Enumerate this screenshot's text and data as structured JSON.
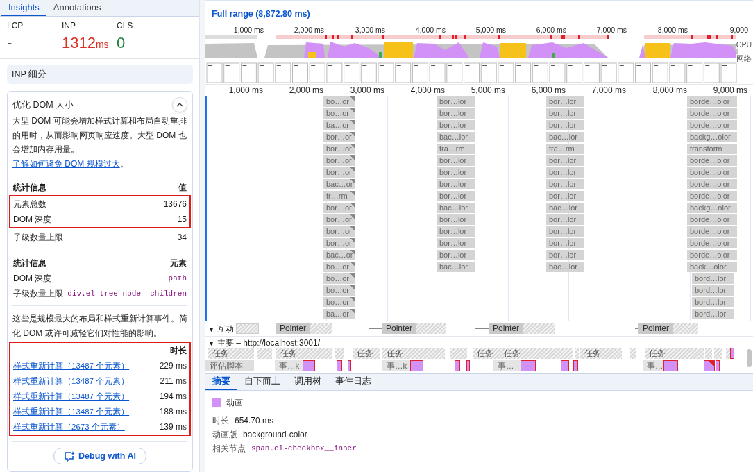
{
  "sidebar": {
    "tabs": [
      {
        "label": "Insights",
        "selected": true
      },
      {
        "label": "Annotations",
        "selected": false
      }
    ],
    "metrics": [
      {
        "name": "LCP",
        "value": "-",
        "color": "#202124"
      },
      {
        "name": "INP",
        "value": "1312",
        "unit": "ms",
        "color": "#d93025"
      },
      {
        "name": "CLS",
        "value": "0",
        "color": "#188038"
      }
    ],
    "breakdown_card": {
      "title": "INP 细分"
    },
    "insight": {
      "title": "优化 DOM 大小",
      "expanded": true,
      "description": "大型 DOM 可能会增加样式计算和布局自动重排的用时，从而影响网页响应速度。大型 DOM 也会增加内存用量。",
      "link": "了解如何避免 DOM 规模过大",
      "after_link": "。",
      "stats_table": {
        "columns": [
          "统计信息",
          "值"
        ],
        "rows": [
          {
            "label": "元素总数",
            "value": "13676",
            "highlighted": true
          },
          {
            "label": "DOM 深度",
            "value": "15",
            "highlighted": true
          },
          {
            "label": "子级数量上限",
            "value": "34",
            "highlighted": false
          }
        ]
      },
      "elements_table": {
        "columns": [
          "统计信息",
          "元素"
        ],
        "rows": [
          {
            "label": "DOM 深度",
            "node": "path"
          },
          {
            "label": "子级数量上限",
            "node": "div.el-tree-node__children"
          }
        ]
      },
      "events_note": "这些是规模最大的布局和样式重新计算事件。简化 DOM 或许可减轻它们对性能的影响。",
      "events_table": {
        "highlighted": true,
        "column": "时长",
        "rows": [
          {
            "label": "样式重新计算（13487 个元素）",
            "duration": "229 ms"
          },
          {
            "label": "样式重新计算（13487 个元素）",
            "duration": "211 ms"
          },
          {
            "label": "样式重新计算（13487 个元素）",
            "duration": "194 ms"
          },
          {
            "label": "样式重新计算（13487 个元素）",
            "duration": "188 ms"
          },
          {
            "label": "样式重新计算（2673 个元素）",
            "duration": "139 ms"
          }
        ]
      },
      "ai_button": "Debug with AI"
    }
  },
  "timeline": {
    "title": "Full range (8,872.80 ms)",
    "overview_ticks": [
      "1,000 ms",
      "2,000 ms",
      "3,000 ms",
      "4,000 ms",
      "5,000 ms",
      "6,000 ms",
      "7,000 ms",
      "8,000 ms",
      "9,000"
    ],
    "cpu_label": "CPU",
    "network_label": "网络",
    "ticks": [
      "1,000 ms",
      "2,000 ms",
      "3,000 ms",
      "4,000 ms",
      "5,000 ms",
      "6,000 ms",
      "7,000 ms",
      "8,000 ms",
      "9,000 ms"
    ],
    "animation_columns": [
      {
        "labels": [
          "bo…or",
          "bo…or",
          "ba…or",
          "bor…or",
          "bor…or",
          "bor…or",
          "bor…or",
          "bac…or",
          "tr…rm",
          "bor…or",
          "bor…or",
          "bor…or",
          "bor…or",
          "bac…or",
          "bo…or",
          "bo…or",
          "bo…or",
          "bo…or",
          "ba…or"
        ]
      },
      {
        "labels": [
          "bor…lor",
          "bor…lor",
          "bor…lor",
          "bac…lor",
          "tra…rm",
          "bor…lor",
          "bor…lor",
          "bor…lor",
          "bor…lor",
          "bac…lor",
          "bor…lor",
          "bor…lor",
          "bor…lor",
          "bor…lor",
          "bac…lor"
        ]
      },
      {
        "labels": [
          "bor…lor",
          "bor…lor",
          "bor…lor",
          "bac…lor",
          "tra…rm",
          "bor…lor",
          "bor…lor",
          "bor…lor",
          "bor…lor",
          "bac…lor",
          "bor…lor",
          "bor…lor",
          "bor…lor",
          "bor…lor",
          "bac…lor"
        ]
      },
      {
        "labels": [
          "borde…olor",
          "borde…olor",
          "borde…olor",
          "backg…olor",
          "transform",
          "borde…olor",
          "borde…olor",
          "borde…olor",
          "borde…olor",
          "backg…olor",
          "borde…olor",
          "borde…olor",
          "borde…olor",
          "borde…olor",
          "back…olor",
          "bord…lor",
          "bord…lor",
          "bord…lor",
          "bord…lor"
        ]
      }
    ],
    "interactions": {
      "label": "互动",
      "toggle": "▼",
      "events": [
        "Pointer",
        "Pointer",
        "Pointer",
        "Pointer"
      ]
    },
    "main": {
      "label": "主要 – http://localhost:3001/",
      "toggle": "▼",
      "tasks": [
        "任务",
        "任务",
        "任务",
        "任务",
        "任务",
        "任务",
        "任务",
        "任务"
      ],
      "script_label": "评估脚本",
      "script_events": [
        "事…k",
        "事…k",
        "事…",
        "事…"
      ]
    }
  },
  "details": {
    "tabs": [
      {
        "label": "摘要",
        "selected": true
      },
      {
        "label": "自下而上",
        "selected": false
      },
      {
        "label": "调用树",
        "selected": false
      },
      {
        "label": "事件日志",
        "selected": false
      }
    ],
    "category": "动画",
    "rows": [
      {
        "label": "时长",
        "value": "654.70 ms",
        "kind": "text"
      },
      {
        "label": "动画版",
        "value": "background-color",
        "kind": "text"
      },
      {
        "label": "相关节点",
        "value": "span.el-checkbox__inner",
        "kind": "node"
      }
    ]
  }
}
